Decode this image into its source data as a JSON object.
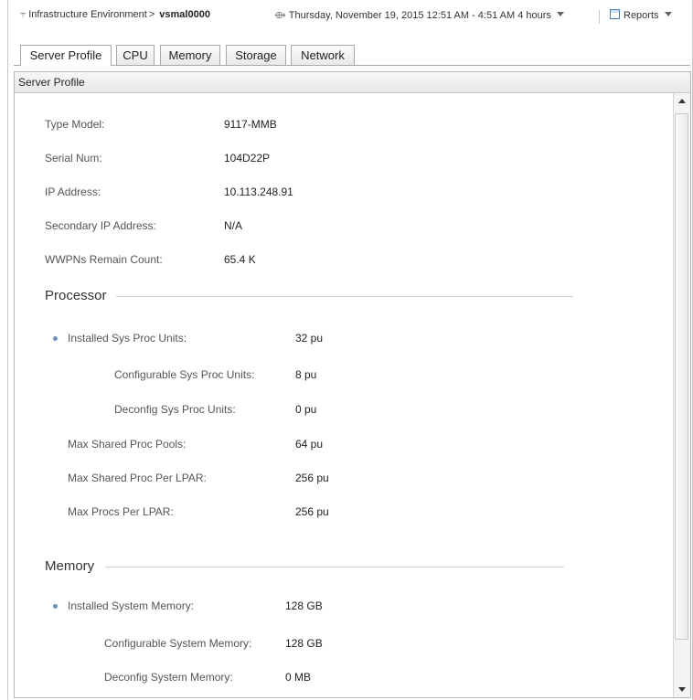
{
  "header": {
    "breadcrumb_parent": "Infrastructure Environment",
    "breadcrumb_separator": ">",
    "breadcrumb_current": "vsmal0000",
    "time_range": "Thursday, November 19, 2015 12:51 AM - 4:51 AM 4 hours",
    "reports_label": "Reports"
  },
  "tabs": [
    "Server Profile",
    "CPU",
    "Memory",
    "Storage",
    "Network"
  ],
  "panel": {
    "title": "Server Profile",
    "general": [
      {
        "label": "Type Model:",
        "value": "9117-MMB"
      },
      {
        "label": "Serial Num:",
        "value": "104D22P"
      },
      {
        "label": "IP Address:",
        "value": "10.113.248.91"
      },
      {
        "label": "Secondary IP Address:",
        "value": "N/A"
      },
      {
        "label": "WWPNs Remain Count:",
        "value": "65.4 K"
      }
    ],
    "processor": {
      "title": "Processor",
      "installed": {
        "label": "Installed Sys Proc Units:",
        "value": "32 pu"
      },
      "configurable": {
        "label": "Configurable Sys Proc Units:",
        "value": "8 pu"
      },
      "deconfig": {
        "label": "Deconfig Sys Proc Units:",
        "value": "0 pu"
      },
      "max_shared_pools": {
        "label": "Max Shared Proc Pools:",
        "value": "64 pu"
      },
      "max_shared_per_lpar": {
        "label": "Max Shared Proc Per LPAR:",
        "value": "256 pu"
      },
      "max_procs_per_lpar": {
        "label": "Max Procs Per LPAR:",
        "value": "256 pu"
      }
    },
    "memory": {
      "title": "Memory",
      "installed": {
        "label": "Installed System Memory:",
        "value": "128 GB"
      },
      "configurable": {
        "label": "Configurable System Memory:",
        "value": "128 GB"
      },
      "deconfig": {
        "label": "Deconfig System Memory:",
        "value": "0 MB"
      }
    }
  },
  "colors": {
    "bullet": "#6f93b6",
    "border": "#b8b8b8"
  },
  "icons": [
    "home-icon",
    "clock-icon",
    "dropdown-arrow-icon",
    "reports-icon",
    "scroll-up-icon",
    "scroll-down-icon"
  ]
}
